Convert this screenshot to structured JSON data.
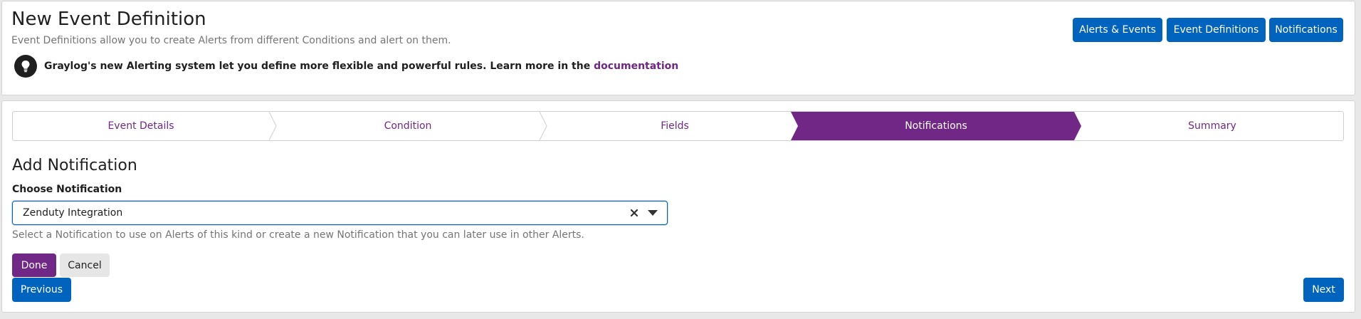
{
  "header": {
    "title": "New Event Definition",
    "description": "Event Definitions allow you to create Alerts from different Conditions and alert on them.",
    "tip_text": "Graylog's new Alerting system let you define more flexible and powerful rules. Learn more in the ",
    "tip_link": "documentation",
    "buttons": {
      "alerts_events": "Alerts & Events",
      "event_definitions": "Event Definitions",
      "notifications": "Notifications"
    }
  },
  "wizard": {
    "steps": [
      {
        "label": "Event Details",
        "active": false
      },
      {
        "label": "Condition",
        "active": false
      },
      {
        "label": "Fields",
        "active": false
      },
      {
        "label": "Notifications",
        "active": true
      },
      {
        "label": "Summary",
        "active": false
      }
    ]
  },
  "form": {
    "section_title": "Add Notification",
    "field_label": "Choose Notification",
    "selected_value": "Zenduty Integration",
    "help_text": "Select a Notification to use on Alerts of this kind or create a new Notification that you can later use in other Alerts.",
    "done_label": "Done",
    "cancel_label": "Cancel"
  },
  "nav": {
    "previous_label": "Previous",
    "next_label": "Next"
  },
  "colors": {
    "primary_blue": "#0063be",
    "accent_purple": "#702785",
    "muted_text": "#757575"
  },
  "icons": [
    "lightbulb-icon",
    "clear-icon",
    "caret-down-icon"
  ]
}
